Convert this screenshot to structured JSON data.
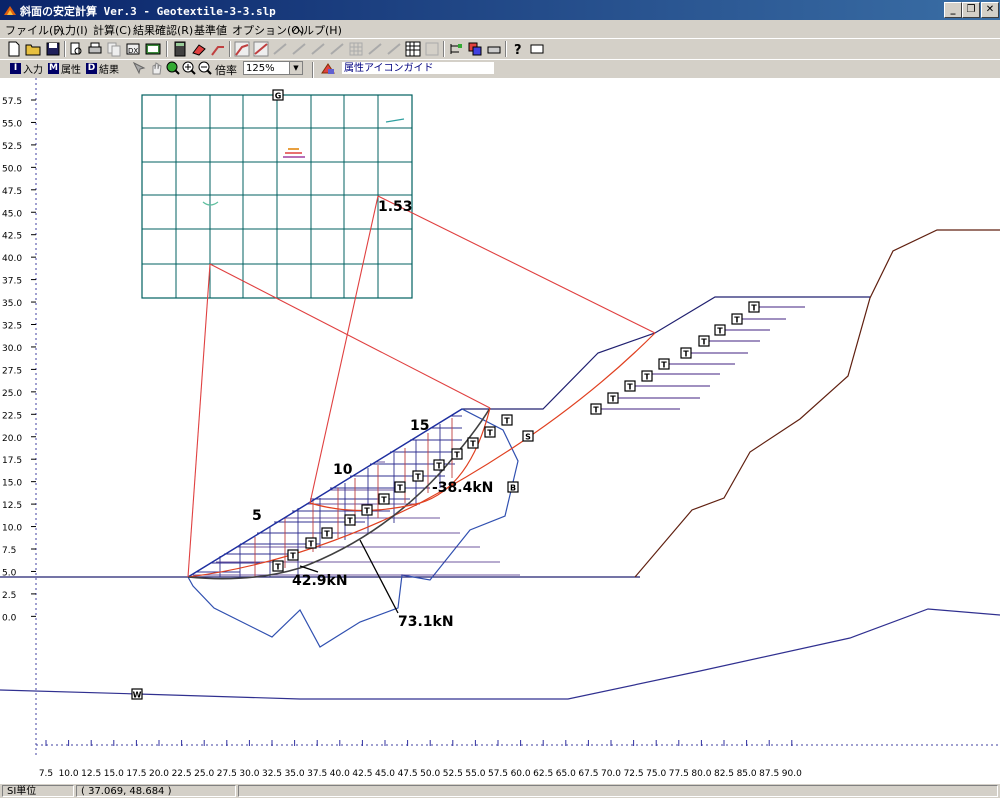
{
  "window": {
    "title": "斜面の安定計算 Ver.3 - Geotextile-3-3.slp"
  },
  "menu": [
    "ファイル(F)",
    "入力(I)",
    "計算(C)",
    "結果確認(R)",
    "基準値",
    "オプション(O)",
    "ヘルプ(H)"
  ],
  "mode_buttons": [
    {
      "key": "I",
      "label": "入力"
    },
    {
      "key": "M",
      "label": "属性"
    },
    {
      "key": "D",
      "label": "結果"
    }
  ],
  "zoom": {
    "label": "倍率",
    "value": "125%"
  },
  "attribute_guide": "属性アイコンガイド",
  "status": {
    "unit": "SI単位",
    "coords": "( 37.069,  48.684 )"
  },
  "chart_data": {
    "type": "diagram",
    "y_ticks": [
      "57.5",
      "55.0",
      "52.5",
      "50.0",
      "47.5",
      "45.0",
      "42.5",
      "40.0",
      "37.5",
      "35.0",
      "32.5",
      "30.0",
      "27.5",
      "25.0",
      "22.5",
      "20.0",
      "17.5",
      "15.0",
      "12.5",
      "10.0",
      "7.5",
      "5.0",
      "2.5",
      "0.0"
    ],
    "x_ticks": [
      "7.5",
      "10.0",
      "12.5",
      "15.0",
      "17.5",
      "20.0",
      "22.5",
      "25.0",
      "27.5",
      "30.0",
      "32.5",
      "35.0",
      "37.5",
      "40.0",
      "42.5",
      "45.0",
      "47.5",
      "50.0",
      "52.5",
      "55.0",
      "57.5",
      "60.0",
      "62.5",
      "65.0",
      "67.5",
      "70.0",
      "72.5",
      "75.0",
      "77.5",
      "80.0",
      "82.5",
      "85.0",
      "87.5",
      "90.0"
    ],
    "safety_factor": "1.53",
    "slice_labels": [
      "5",
      "10",
      "15"
    ],
    "force_labels": [
      "-38.4kN",
      "42.9kN",
      "73.1kN"
    ],
    "markers": {
      "T": "T",
      "S": "S",
      "B": "B",
      "G": "G",
      "W": "W"
    }
  }
}
